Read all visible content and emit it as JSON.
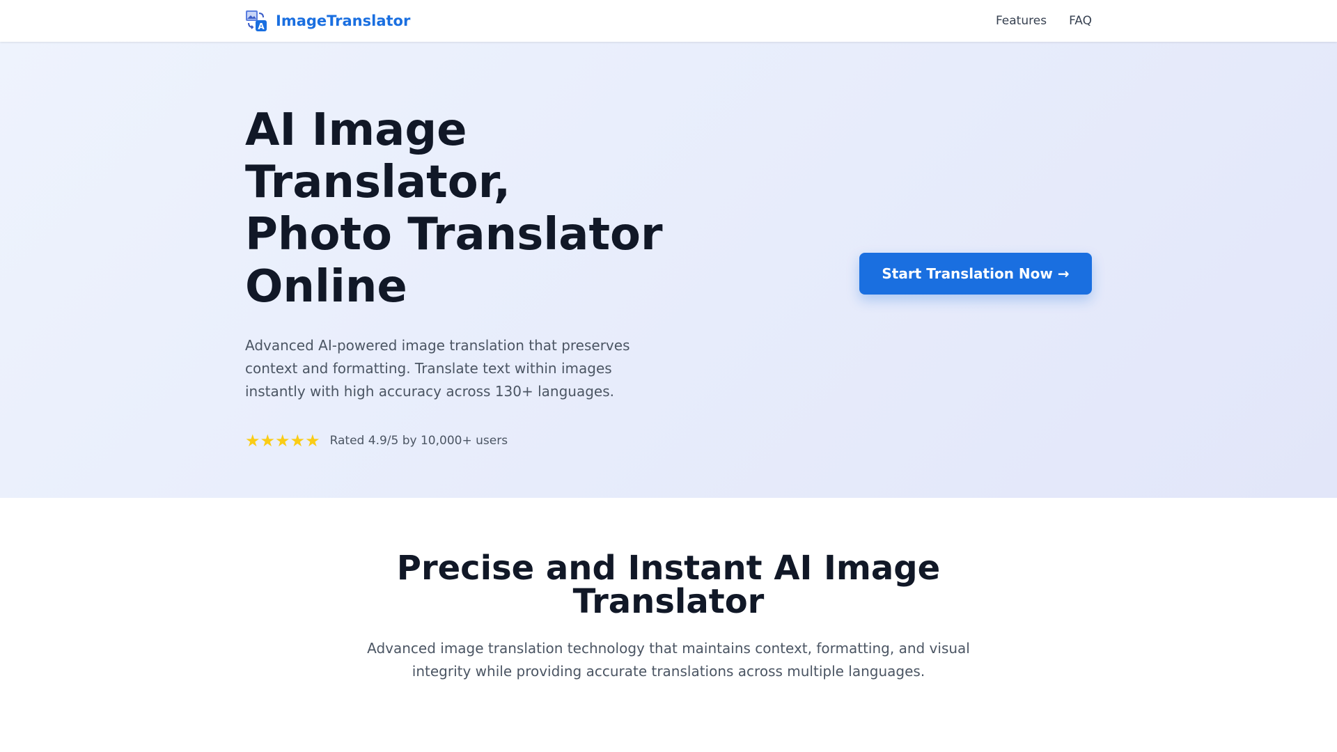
{
  "header": {
    "logo_text": "ImageTranslator",
    "logo_icon": "image-translate-icon",
    "nav": [
      {
        "label": "Features"
      },
      {
        "label": "FAQ"
      }
    ]
  },
  "hero": {
    "title_lines": [
      "AI Image",
      "Translator,",
      "Photo Translator",
      "Online"
    ],
    "description": "Advanced AI-powered image translation that preserves context and formatting. Translate text within images instantly with high accuracy across 130+ languages.",
    "stars": "★★★★★",
    "rating_value": 5,
    "rating_max": 5,
    "rating_text": "Rated 4.9/5 by 10,000+ users",
    "cta_label": "Start Translation Now →"
  },
  "features": {
    "title": "Precise and Instant AI Image Translator",
    "description": "Advanced image translation technology that maintains context, formatting, and visual integrity while providing accurate translations across multiple languages."
  },
  "colors": {
    "brand": "#1a6fe0",
    "heading": "#111827",
    "body_text": "#4b5563",
    "star": "#facc15",
    "hero_bg_start": "#eef3fd",
    "hero_bg_end": "#e2e6f9"
  }
}
